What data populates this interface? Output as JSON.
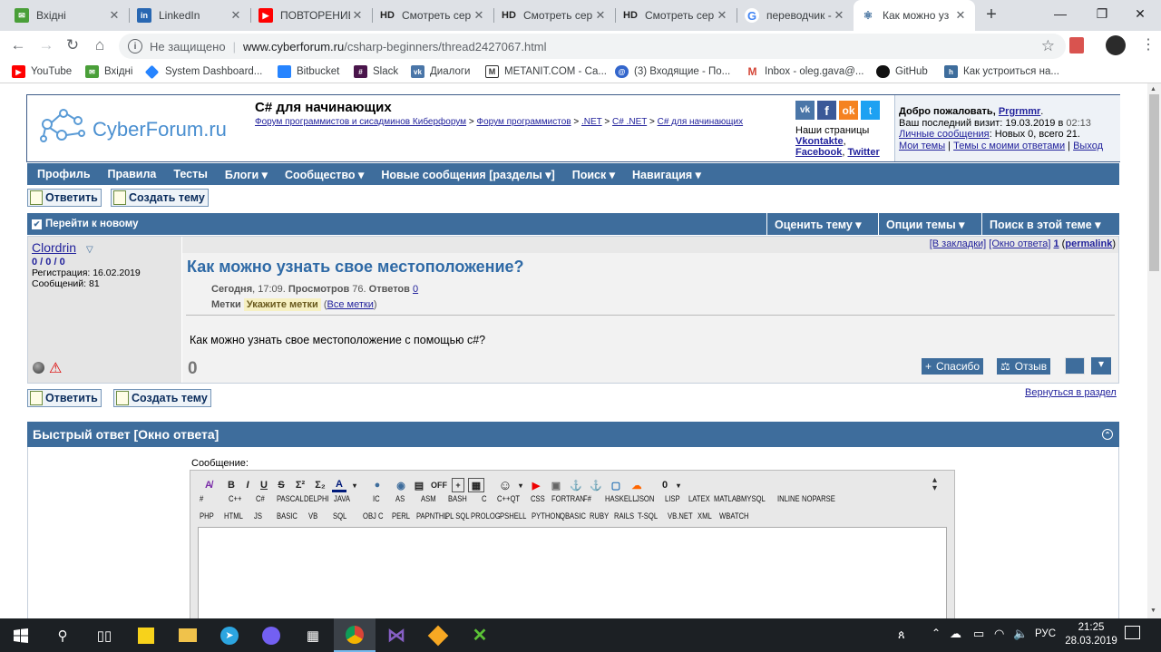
{
  "browser": {
    "tabs": [
      {
        "label": "Вхідні",
        "icon": "gmail-icon",
        "color": "#4a9f39"
      },
      {
        "label": "LinkedIn",
        "icon": "linkedin-icon",
        "color": "#2867b2"
      },
      {
        "label": "ПОВТОРЕНИЕ",
        "icon": "youtube-icon",
        "color": "#ff0000"
      },
      {
        "label": "Смотреть сер",
        "icon": "hd-icon",
        "color": "#222222"
      },
      {
        "label": "Смотреть сер",
        "icon": "hd-icon",
        "color": "#222222"
      },
      {
        "label": "Смотреть сер",
        "icon": "hd-icon",
        "color": "#222222"
      },
      {
        "label": "переводчик -",
        "icon": "google-icon",
        "color": "#4285f4"
      },
      {
        "label": "Как можно уз",
        "icon": "cyberforum-icon",
        "color": "#3e6d9c"
      }
    ],
    "new_tab": "+",
    "security": "Не защищено",
    "url_host": "www.cyberforum.ru",
    "url_path": "/csharp-beginners/thread2427067.html",
    "bookmarks": [
      {
        "label": "YouTube",
        "color": "#ff0000"
      },
      {
        "label": "Вхідні",
        "color": "#4a9f39"
      },
      {
        "label": "System Dashboard...",
        "color": "#2684ff"
      },
      {
        "label": "Bitbucket",
        "color": "#2684ff"
      },
      {
        "label": "Slack",
        "color": "#4a154b"
      },
      {
        "label": "Диалоги",
        "color": "#4a76a8"
      },
      {
        "label": "METANIT.COM - Са...",
        "color": "#333333"
      },
      {
        "label": "(3) Входящие - По...",
        "color": "#3366cc"
      },
      {
        "label": "Inbox - oleg.gava@...",
        "color": "#d44638"
      },
      {
        "label": "GitHub",
        "color": "#111111"
      },
      {
        "label": "Как устроиться на...",
        "color": "#3e6d9c"
      }
    ]
  },
  "forum": {
    "logo": "CyberForum.ru",
    "title": "C# для начинающих",
    "breadcrumb": [
      "Форум программистов и сисадминов Киберфорум",
      "Форум программистов",
      ".NET",
      "C# .NET",
      "C# для начинающих"
    ],
    "social_label": "Наши страницы",
    "social_links": [
      "Vkontakte",
      "Facebook",
      "Twitter"
    ],
    "welcome": "Добро пожаловать,",
    "username": "Prgrmmr",
    "last_visit": "Ваш последний визит: 19.03.2019 в",
    "last_visit_time": "02:13",
    "pm_link": "Личные сообщения",
    "pm_status": ": Новых 0, всего 21.",
    "my_threads": "Мои темы",
    "my_replies": "Темы с моими ответами",
    "logout": "Выход",
    "nav": [
      "Профиль",
      "Правила",
      "Тесты",
      "Блоги ▾",
      "Сообщество ▾",
      "Новые сообщения [разделы ▾]",
      "Поиск ▾",
      "Навигация ▾"
    ],
    "reply_btn": "Ответить",
    "newthread_btn": "Создать тему",
    "goto_new": "Перейти к новому",
    "rate": "Оценить тему ▾",
    "options": "Опции темы ▾",
    "search_thread": "Поиск в этой теме ▾",
    "post": {
      "author": "Clordrin",
      "stats": "0 / 0 / 0",
      "reg": "Регистрация: 16.02.2019",
      "msgs": "Сообщений: 81",
      "bookmarks": "[В закладки]",
      "reply_window": "[Окно ответа]",
      "number": "1",
      "permalink": "permalink",
      "title": "Как можно узнать свое местоположение?",
      "date": "Сегодня",
      "time": ", 17:09.",
      "views_label": "Просмотров",
      "views": "76.",
      "answers_label": "Ответов",
      "answers": "0",
      "tags_label": "Метки",
      "tags_value": "Укажите метки",
      "all_tags": "Все метки",
      "body": "Как можно узнать свое местоположение с помощью c#?",
      "rating": "0",
      "thanks": "Спасибо",
      "review": "Отзыв"
    },
    "back_link": "Вернуться в раздел",
    "quick_reply": "Быстрый ответ [Окно ответа]",
    "message_label": "Сообщение:",
    "editor_row1": [
      "B",
      "I",
      "U",
      "S",
      "Σ²",
      "Σ₂",
      "A",
      "OFF"
    ],
    "lang_row1": [
      "#",
      "C++",
      "C#",
      "PASCAL",
      "DELPHI",
      "JAVA",
      "IC",
      "AS",
      "ASM",
      "BASH",
      "C",
      "C++QT",
      "CSS",
      "FORTRAN",
      "F#",
      "HASKELL",
      "JSON",
      "LISP",
      "LATEX",
      "MATLAB",
      "MYSQL",
      "INLINE",
      "NOPARSE"
    ],
    "lang_row2": [
      "PHP",
      "HTML",
      "JS",
      "BASIC",
      "VB",
      "SQL",
      "OBJ C",
      "PERL",
      "PAPNTHL",
      "PL SQL",
      "PROLOG",
      "PSHELL",
      "PYTHON",
      "QBASIC",
      "RUBY",
      "RAILS",
      "T-SQL",
      "VB.NET",
      "XML",
      "WBATCH"
    ]
  },
  "taskbar": {
    "lang": "РУС",
    "time": "21:25",
    "date": "28.03.2019"
  }
}
